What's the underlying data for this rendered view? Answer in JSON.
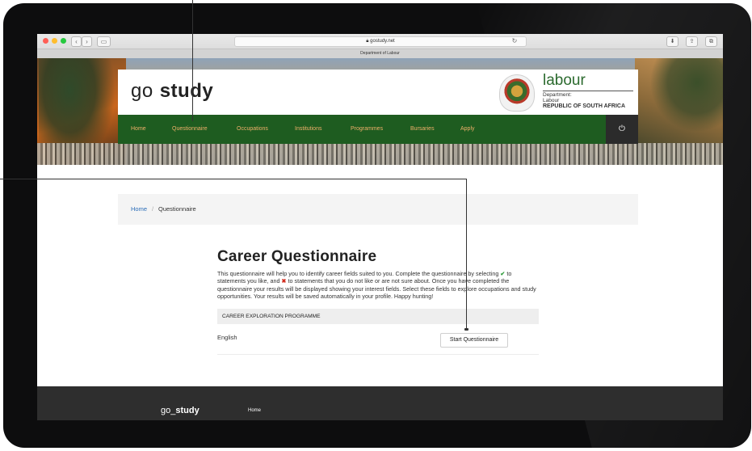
{
  "browser": {
    "url": "gostudy.net",
    "tab_title": "Department of Labour",
    "reader_icon": "reader-icon",
    "reload_icon": "reload-icon"
  },
  "site": {
    "logo_light": "go",
    "logo_bold": "study",
    "dept_title": "labour",
    "dept_line1": "Department:",
    "dept_line2": "Labour",
    "dept_line3": "REPUBLIC OF SOUTH AFRICA",
    "nav": [
      "Home",
      "Questionnaire",
      "Occupations",
      "Institutions",
      "Programmes",
      "Bursaries",
      "Apply"
    ],
    "login_icon": "login-icon"
  },
  "breadcrumb": {
    "home": "Home",
    "separator": "/",
    "current": "Questionnaire"
  },
  "questionnaire": {
    "title": "Career Questionnaire",
    "intro_1": "This questionnaire will help you to identify career fields suited to you. Complete the questionnaire by selecting ",
    "check_glyph": "✔",
    "intro_2": " to statements you like, and ",
    "cross_glyph": "✖",
    "intro_3": " to statements that you do not like or are not sure about. Once you have completed the questionnaire your results will be displayed showing your interest fields. Select these fields to explore occupations and study opportunities. Your results will be saved automatically in your profile. Happy hunting!",
    "table_header": "CAREER EXPLORATION PROGRAMME",
    "language": "English",
    "start_button": "Start Questionnaire"
  },
  "footer": {
    "logo_light": "go_",
    "logo_bold": "study",
    "link": "Home"
  },
  "colors": {
    "nav_green": "#1e5c20",
    "nav_text": "#f0b06a",
    "link_blue": "#2a6cb8",
    "check_green": "#2e9b3a",
    "cross_red": "#d02a1c"
  }
}
